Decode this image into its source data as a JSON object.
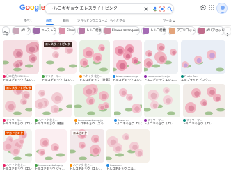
{
  "header": {
    "logo": "Google",
    "query": "トルコギキョウ エレスライトピンク"
  },
  "nav": {
    "tabs": [
      {
        "label": "すべて"
      },
      {
        "label": "画像"
      },
      {
        "label": "動画"
      },
      {
        "label": "ショッピング"
      },
      {
        "label": "ニュース"
      },
      {
        "label": "もっと見る"
      }
    ],
    "tools": "ツール"
  },
  "chips": [
    {
      "label": "ダリア",
      "color": "#c9a6b8"
    },
    {
      "label": "ユーストマ",
      "color": "#9e6aa8"
    },
    {
      "label": "Flower",
      "color": "#d98fa8"
    },
    {
      "label": "トルコ桔梗",
      "color": "#b77aa6"
    },
    {
      "label": "Flower arrangement",
      "color": "#ce8fa6"
    },
    {
      "label": "トルコ桔梗",
      "color": "#a56bb5"
    },
    {
      "label": "アプリコット",
      "color": "#e3a47b"
    },
    {
      "label": "ダリアセット",
      "color": "#c06c8b"
    }
  ],
  "results": [
    {
      "source": "日本花卉 HD.HK...",
      "title": "トルコギキョウ「エレ...",
      "overlay": ""
    },
    {
      "source": "フラワーマ...",
      "title": "トルコギキョウ（エレ...",
      "overlay": "エレスライトピンク"
    },
    {
      "source": "ハナイク 花と...",
      "title": "トルコギキョウ（特選品...",
      "overlay": ""
    },
    {
      "source": "bloomtown.co.jp",
      "title": "トルコギキョウ エレ...",
      "overlay": ""
    },
    {
      "source": "hanamidori.co.jp",
      "title": "トルコギキョウ エレス...",
      "overlay": ""
    },
    {
      "source": "Photo Ac...",
      "title": "エルプライト ピンク...",
      "overlay": ""
    },
    {
      "source": "フラワーマ...",
      "title": "トルコギキョウ（エレ...",
      "overlay": "エレスライトピンク"
    },
    {
      "source": "ハナイク 花と...",
      "title": "トルコギキョウ（種苗...",
      "overlay": ""
    },
    {
      "source": "hanaenwebshop.jp",
      "title": "トルコギキョウ（スキ...",
      "overlay": ""
    },
    {
      "source": "flowers...",
      "title": "トルコギキョウ エレス...",
      "overlay": ""
    },
    {
      "source": "フラワーマ...",
      "title": "トルコギキョウ（エレ...",
      "overlay": ""
    },
    {
      "source": "フラワーマ...",
      "title": "トルコギキョウ（エレ...",
      "overlay": ""
    },
    {
      "source": "ハナイク 花と...",
      "title": "トルコギキョウ（エレ...",
      "overlay": "マカドピンク"
    },
    {
      "source": "hanaenwebshop.jp",
      "title": "トルコギキョウ ジャ...",
      "overlay": ""
    },
    {
      "source": "ハナイク 花と...",
      "title": "トルコギキョウ（エレ...",
      "overlay": "エルピンク"
    },
    {
      "source": "flowers...",
      "title": "トルコギキョウ エル...",
      "overlay": ""
    }
  ]
}
